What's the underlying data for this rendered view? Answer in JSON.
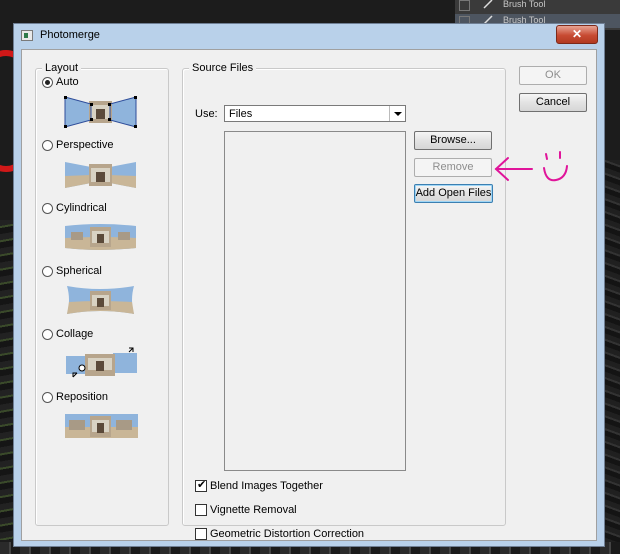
{
  "background": {
    "layer_rows": [
      "Brush Tool",
      "Brush Tool"
    ]
  },
  "window": {
    "title": "Photomerge",
    "close_symbol": "✕"
  },
  "layout": {
    "legend": "Layout",
    "options": [
      {
        "label": "Auto",
        "selected": true,
        "thumb_icon": "auto-projection-icon"
      },
      {
        "label": "Perspective",
        "selected": false,
        "thumb_icon": "perspective-projection-icon"
      },
      {
        "label": "Cylindrical",
        "selected": false,
        "thumb_icon": "cylindrical-projection-icon"
      },
      {
        "label": "Spherical",
        "selected": false,
        "thumb_icon": "spherical-projection-icon"
      },
      {
        "label": "Collage",
        "selected": false,
        "thumb_icon": "collage-projection-icon"
      },
      {
        "label": "Reposition",
        "selected": false,
        "thumb_icon": "reposition-projection-icon"
      }
    ]
  },
  "source_files": {
    "legend": "Source Files",
    "use_label": "Use:",
    "use_value": "Files",
    "files": [],
    "browse_label": "Browse...",
    "remove_label": "Remove",
    "add_open_label": "Add Open Files"
  },
  "actions": {
    "ok_label": "OK",
    "cancel_label": "Cancel"
  },
  "options": {
    "blend_label": "Blend Images Together",
    "blend_checked": true,
    "vignette_label": "Vignette Removal",
    "vignette_checked": false,
    "geometric_label": "Geometric Distortion Correction",
    "geometric_checked": false,
    "check_mark": "✔"
  },
  "annotation": {
    "color": "#e0149a",
    "icon": "arrow-left-icon",
    "smiley_icon": "smiley-icon"
  }
}
